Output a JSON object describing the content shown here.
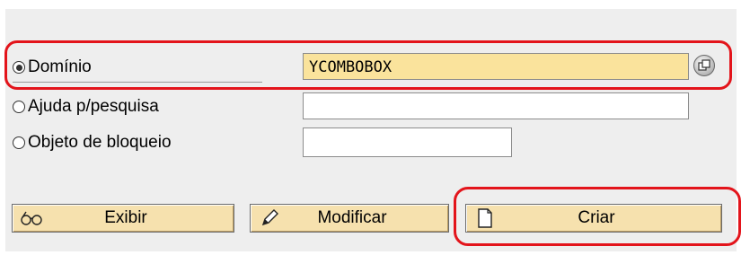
{
  "options": [
    {
      "label": "Domínio",
      "selected": true,
      "value": "YCOMBOBOX"
    },
    {
      "label": "Ajuda p/pesquisa",
      "selected": false,
      "value": ""
    },
    {
      "label": "Objeto de bloqueio",
      "selected": false,
      "value": ""
    }
  ],
  "buttons": {
    "display_label": "Exibir",
    "change_label": "Modificar",
    "create_label": "Criar"
  },
  "colors": {
    "required_field": "#fae39c",
    "button_face": "#f6e1ae",
    "highlight": "#e3141b"
  },
  "icons": {
    "display": "glasses-icon",
    "change": "pencil-icon",
    "create": "blank-document-icon",
    "value_help": "value-help-icon"
  }
}
